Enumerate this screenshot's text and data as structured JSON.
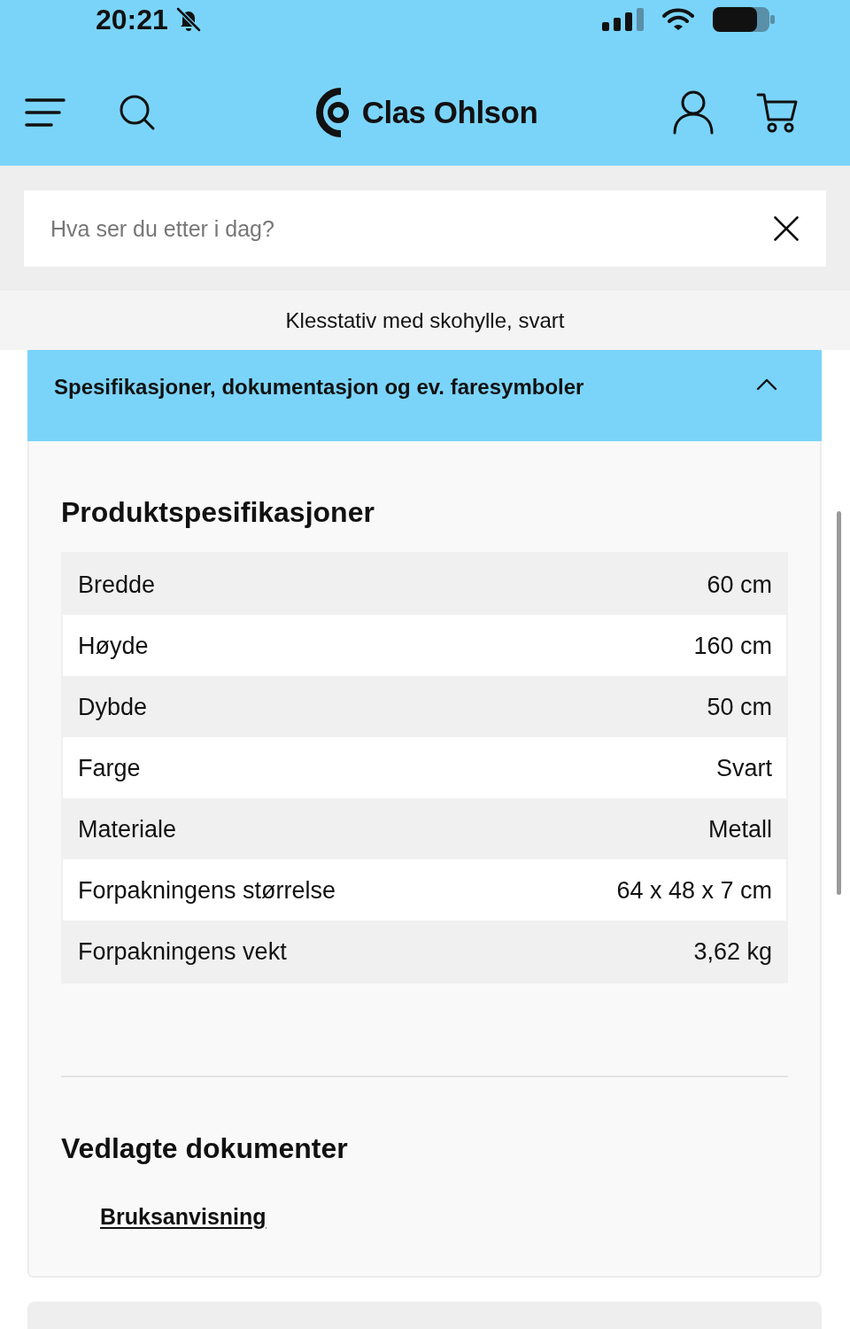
{
  "status_bar": {
    "time": "20:21"
  },
  "header": {
    "logo": "Clas Ohlson"
  },
  "search": {
    "placeholder": "Hva ser du etter i dag?"
  },
  "product_title": "Klesstativ med skohylle, svart",
  "accordion": {
    "title": "Spesifikasjoner, dokumentasjon og ev. faresymboler",
    "expanded": true,
    "sections": [
      {
        "kind": "spec_table",
        "heading": "Produktspesifikasjoner",
        "rows": [
          {
            "label": "Bredde",
            "value": "60 cm"
          },
          {
            "label": "Høyde",
            "value": "160 cm"
          },
          {
            "label": "Dybde",
            "value": "50 cm"
          },
          {
            "label": "Farge",
            "value": "Svart"
          },
          {
            "label": "Materiale",
            "value": "Metall"
          },
          {
            "label": "Forpakningens størrelse",
            "value": "64 x 48 x 7 cm"
          },
          {
            "label": "Forpakningens vekt",
            "value": "3,62 kg"
          }
        ]
      },
      {
        "kind": "documents",
        "heading": "Vedlagte dokumenter",
        "links": [
          "Bruksanvisning"
        ]
      }
    ]
  }
}
